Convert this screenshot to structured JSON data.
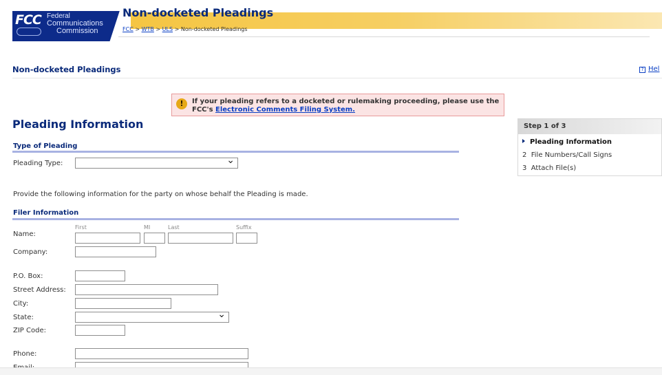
{
  "header": {
    "logo": {
      "fcc": "FCC",
      "line1": "Federal",
      "line2": "Communications",
      "line3": "Commission"
    },
    "page_title": "Non-docketed Pleadings",
    "breadcrumb": {
      "fcc": "FCC",
      "sep": ">",
      "wtb": "WTB",
      "uls": "ULS",
      "current": "Non-docketed Pleadings"
    }
  },
  "section_title": "Non-docketed Pleadings",
  "help_label": "Hel",
  "alert": {
    "icon": "!",
    "text": "If your pleading refers to a docketed or rulemaking proceeding, please use the FCC's ",
    "link": "Electronic Comments Filing System."
  },
  "main_heading": "Pleading Information",
  "type_section": {
    "title": "Type of Pleading",
    "label": "Pleading Type:",
    "value": ""
  },
  "info_text": "Provide the following information for the party on whose behalf the Pleading is made.",
  "filer": {
    "title": "Filer Information",
    "name_label": "Name:",
    "first_label": "First",
    "mi_label": "MI",
    "last_label": "Last",
    "suffix_label": "Suffix",
    "company_label": "Company:",
    "pobox_label": "P.O. Box:",
    "street_label": "Street Address:",
    "city_label": "City:",
    "state_label": "State:",
    "zip_label": "ZIP Code:",
    "phone_label": "Phone:",
    "email_label": "Email:"
  },
  "steps": {
    "header": "Step 1 of 3",
    "items": [
      {
        "num": "",
        "label": "Pleading Information",
        "active": true
      },
      {
        "num": "2",
        "label": "File Numbers/Call Signs",
        "active": false
      },
      {
        "num": "3",
        "label": "Attach File(s)",
        "active": false
      }
    ]
  },
  "colors": {
    "brand_blue": "#0a2a7a",
    "gold": "#f5c542",
    "link": "#0a3fc4",
    "alert_bg": "#fbe4e4",
    "section_bar": "#a8b2e2"
  }
}
